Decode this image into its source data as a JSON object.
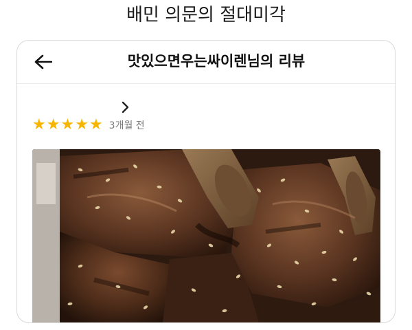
{
  "caption": "배민 의문의 절대미각",
  "header": {
    "title": "맛있으면우는싸이렌님의 리뷰",
    "back_icon": "arrow-left-icon"
  },
  "review": {
    "chevron_icon": "chevron-right-icon",
    "rating": 5,
    "rating_max": 5,
    "time_ago": "3개월 전",
    "photo": "grilled-short-ribs-photo"
  },
  "colors": {
    "star": "#f7b500",
    "border": "#d9d9d9"
  }
}
